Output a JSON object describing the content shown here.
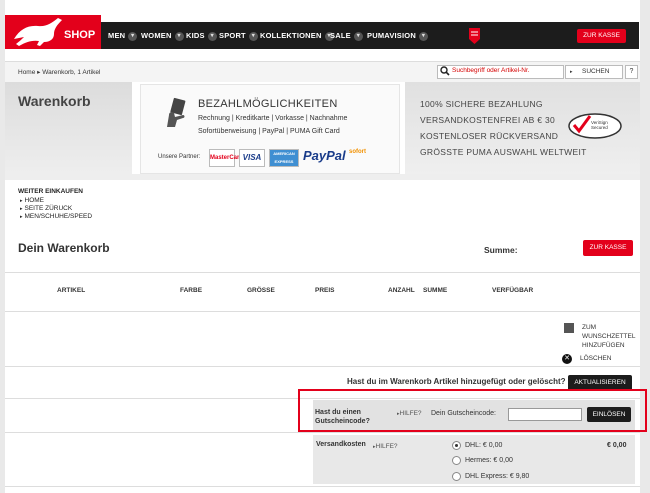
{
  "nav": {
    "shop": "SHOP",
    "items": [
      "MEN",
      "WOMEN",
      "KIDS",
      "SPORT",
      "KOLLEKTIONEN",
      "SALE",
      "PUMAVISION"
    ],
    "checkout": "ZUR KASSE"
  },
  "breadcrumb": "Home ▸ Warenkorb, 1 Artikel",
  "search": {
    "placeholder": "Suchbegriff oder Artikel-Nr.",
    "button": "SUCHEN",
    "help": "?"
  },
  "banner": {
    "title": "Warenkorb",
    "payment_title": "BEZAHLMÖGLICHKEITEN",
    "payment_line1": "Rechnung | Kreditkarte | Vorkasse | Nachnahme",
    "payment_line2": "Sofortüberweisung | PayPal | PUMA Gift Card",
    "partners_label": "Unsere Partner:",
    "cards": [
      "MasterCard",
      "VISA",
      "AMERICAN EXPRESS"
    ],
    "paypal": "PayPal",
    "sofort": "sofort",
    "promises": [
      "100% SICHERE BEZAHLUNG",
      "VERSANDKOSTENFREI AB € 30",
      "KOSTENLOSER RÜCKVERSAND",
      "GRÖSSTE PUMA AUSWAHL WELTWEIT"
    ],
    "verisign": "VeriSign Secured"
  },
  "continue": {
    "title": "WEITER EINKAUFEN",
    "links": [
      "HOME",
      "SEITE ZÜRUCK",
      "MEN/SCHUHE/SPEED"
    ]
  },
  "cart": {
    "title": "Dein Warenkorb",
    "sum_label": "Summe:",
    "checkout": "ZUR KASSE",
    "columns": [
      "ARTIKEL",
      "FARBE",
      "GRÖSSE",
      "PREIS",
      "ANZAHL",
      "SUMME",
      "VERFÜGBAR"
    ],
    "wishlist": "ZUM WUNSCHZETTEL HINZUFÜGEN",
    "delete": "LÖSCHEN",
    "update_question": "Hast du im Warenkorb Artikel hinzugefügt oder gelöscht?",
    "update_button": "AKTUALISIEREN"
  },
  "voucher": {
    "question": "Hast du einen Gutscheincode?",
    "help": "HILFE?",
    "label": "Dein Gutscheincode:",
    "value": "",
    "button": "EINLÖSEN"
  },
  "shipping": {
    "label": "Versandkosten",
    "help": "HILFE?",
    "options": [
      "DHL: € 0,00",
      "Hermes: € 0,00",
      "DHL Express: € 9,80"
    ],
    "price": "€ 0,00"
  },
  "colors": {
    "brand_red": "#e3001b",
    "dark": "#1c1c1c"
  }
}
